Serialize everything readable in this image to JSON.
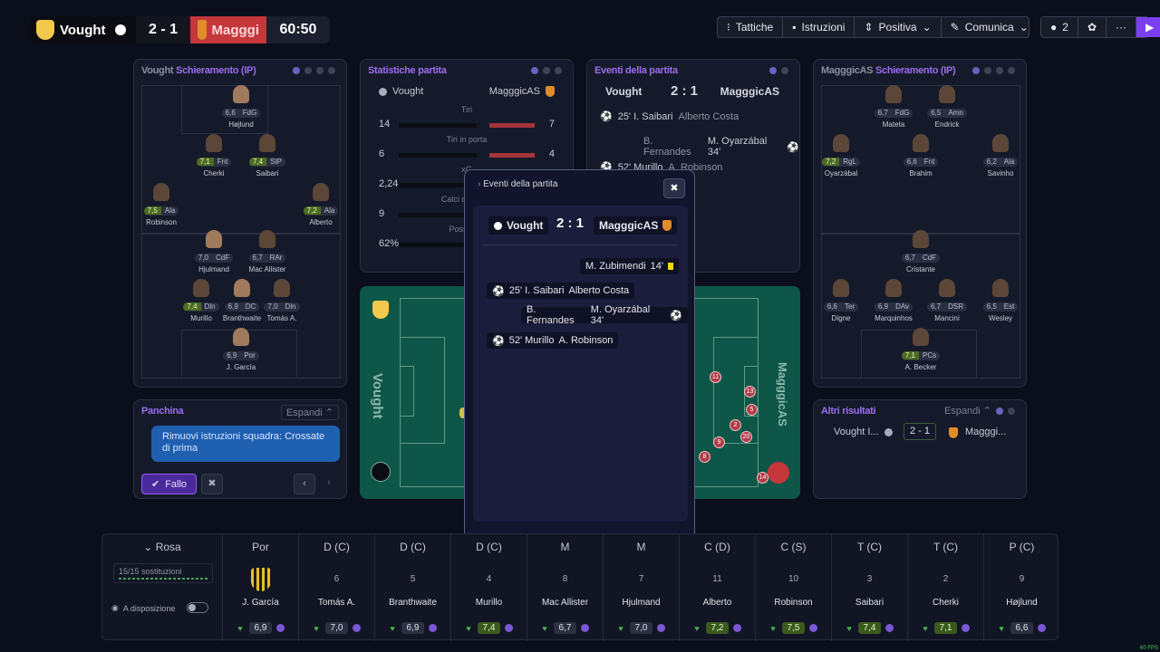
{
  "scoreboard": {
    "home_team": "Vought",
    "score": "2 - 1",
    "away_team": "Magggi",
    "time": "60:50",
    "home_color": "#0b0c12",
    "away_color": "#c4373b"
  },
  "toolbar": {
    "tactics": "Tattiche",
    "instructions": "Istruzioni",
    "mentality": "Positiva",
    "communicate": "Comunica",
    "players_count": "2"
  },
  "home_lineup": {
    "title_team": "Vought",
    "title_label": "Schieramento (IP)",
    "players": [
      {
        "rating": "6,6",
        "role": "FdG",
        "name": "Højlund"
      },
      {
        "rating": "7,1",
        "role": "Fnt",
        "name": "Cherki"
      },
      {
        "rating": "7,4",
        "role": "StP",
        "name": "Saibari"
      },
      {
        "rating": "7,5",
        "role": "Ala",
        "name": "Robinson"
      },
      {
        "rating": "7,2",
        "role": "Ala",
        "name": "Alberto"
      },
      {
        "rating": "7,0",
        "role": "CdF",
        "name": "Hjulmand"
      },
      {
        "rating": "6,7",
        "role": "RAr",
        "name": "Mac Allister"
      },
      {
        "rating": "7,4",
        "role": "Dln",
        "name": "Murillo"
      },
      {
        "rating": "6,9",
        "role": "DC",
        "name": "Branthwaite"
      },
      {
        "rating": "7,0",
        "role": "Dln",
        "name": "Tomás A."
      },
      {
        "rating": "6,9",
        "role": "Por",
        "name": "J. García"
      }
    ]
  },
  "stats": {
    "title": "Statistiche partita",
    "home": "Vought",
    "away": "MagggicAS",
    "rows": [
      {
        "label": "Tiri",
        "home": "14",
        "away": "7"
      },
      {
        "label": "Tiri in porta",
        "home": "6",
        "away": "4"
      },
      {
        "label": "xG",
        "home": "2,24",
        "away": ""
      },
      {
        "label": "Calci d'angolo",
        "home": "9",
        "away": ""
      },
      {
        "label": "Possesso",
        "home": "62%",
        "away": ""
      }
    ]
  },
  "events_panel": {
    "title": "Eventi della partita",
    "home": "Vought",
    "score": "2 : 1",
    "away": "MagggicAS",
    "events": [
      {
        "text": "25' I. Saibari",
        "assist": "Alberto Costa"
      },
      {
        "text": "B. Fernandes",
        "assist": "M. Oyarzábal 34'"
      },
      {
        "text": "52' Murillo",
        "assist": "A. Robinson"
      }
    ]
  },
  "away_lineup": {
    "title_team": "MagggicAS",
    "title_label": "Schieramento (IP)",
    "players": [
      {
        "rating": "6,7",
        "role": "FdG",
        "name": "Mateta"
      },
      {
        "rating": "6,5",
        "role": "Amn",
        "name": "Endrick"
      },
      {
        "rating": "7,2",
        "role": "RgL",
        "name": "Oyarzábal"
      },
      {
        "rating": "6,6",
        "role": "Fnt",
        "name": "Brahim"
      },
      {
        "rating": "6,2",
        "role": "Ala",
        "name": "Savinho"
      },
      {
        "rating": "6,7",
        "role": "CdF",
        "name": "Cristante"
      },
      {
        "rating": "6,6",
        "role": "Ter",
        "name": "Digne"
      },
      {
        "rating": "6,9",
        "role": "DAv",
        "name": "Marquinhos"
      },
      {
        "rating": "6,7",
        "role": "DSR",
        "name": "Mancini"
      },
      {
        "rating": "6,5",
        "role": "Est",
        "name": "Wesley"
      },
      {
        "rating": "7,1",
        "role": "PCs",
        "name": "A. Becker"
      }
    ]
  },
  "pitch": {
    "home_label": "Vought",
    "away_label": "MagggicAS",
    "markers": [
      "11",
      "13",
      "5",
      "2",
      "20",
      "9",
      "8",
      "14"
    ]
  },
  "bench_panel": {
    "title": "Panchina",
    "expand": "Espandi",
    "message": "Rimuovi istruzioni squadra: Crossate di prima",
    "foul_button": "Fallo"
  },
  "results_panel": {
    "title": "Altri risultati",
    "expand": "Espandi",
    "home": "Vought I...",
    "score": "2 - 1",
    "away": "Magggi..."
  },
  "modal": {
    "title": "Eventi della partita",
    "home": "Vought",
    "score": "2 : 1",
    "away": "MagggicAS",
    "events": [
      {
        "text": "M. Zubimendi",
        "minute": "14'",
        "type": "yellow-card"
      },
      {
        "text": "25'  I. Saibari",
        "assist": "Alberto Costa",
        "type": "goal"
      },
      {
        "text": "B. Fernandes",
        "assist": "M. Oyarzábal 34'",
        "type": "goal"
      },
      {
        "text": "52'  Murillo",
        "assist": "A. Robinson",
        "type": "goal"
      }
    ]
  },
  "squad": {
    "title": "Rosa",
    "subs": "15/15 sostituzioni",
    "available": "A disposizione",
    "players": [
      {
        "pos": "Por",
        "num": "",
        "name": "J. García",
        "rating": "6,9",
        "green": false
      },
      {
        "pos": "D (C)",
        "num": "6",
        "name": "Tomás A.",
        "rating": "7,0",
        "green": false
      },
      {
        "pos": "D (C)",
        "num": "5",
        "name": "Branthwaite",
        "rating": "6,9",
        "green": false
      },
      {
        "pos": "D (C)",
        "num": "4",
        "name": "Murillo",
        "rating": "7,4",
        "green": true
      },
      {
        "pos": "M",
        "num": "8",
        "name": "Mac Allister",
        "rating": "6,7",
        "green": false
      },
      {
        "pos": "M",
        "num": "7",
        "name": "Hjulmand",
        "rating": "7,0",
        "green": false
      },
      {
        "pos": "C (D)",
        "num": "11",
        "name": "Alberto",
        "rating": "7,2",
        "green": true
      },
      {
        "pos": "C (S)",
        "num": "10",
        "name": "Robinson",
        "rating": "7,5",
        "green": true
      },
      {
        "pos": "T (C)",
        "num": "3",
        "name": "Saibari",
        "rating": "7,4",
        "green": true
      },
      {
        "pos": "T (C)",
        "num": "2",
        "name": "Cherki",
        "rating": "7,1",
        "green": true
      },
      {
        "pos": "P (C)",
        "num": "9",
        "name": "Højlund",
        "rating": "6,6",
        "green": false
      }
    ]
  },
  "fps": "60 FPS"
}
